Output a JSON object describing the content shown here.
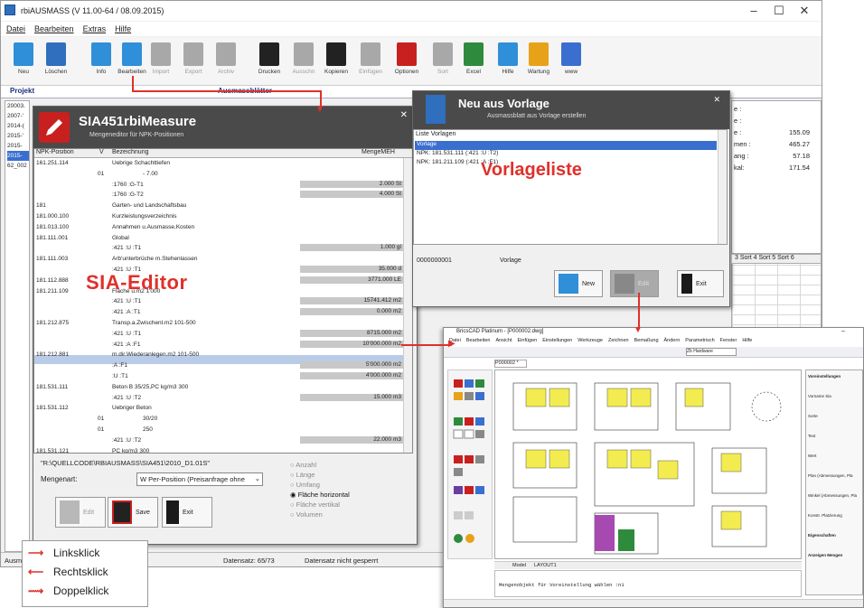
{
  "main": {
    "title": "rbiAUSMASS (V 11.00-64 / 08.09.2015)",
    "menu": [
      "Datei",
      "Bearbeiten",
      "Extras",
      "Hilfe"
    ],
    "toolbar": [
      {
        "label": "Neu",
        "color": "#2f8fd8",
        "enabled": true
      },
      {
        "label": "Löschen",
        "color": "#2f6fbd",
        "enabled": true
      },
      {
        "label": "Info",
        "color": "#2f8fd8",
        "enabled": true
      },
      {
        "label": "Bearbeiten",
        "color": "#2f8fd8",
        "enabled": true
      },
      {
        "label": "Import",
        "color": "#a8a8a8",
        "enabled": false
      },
      {
        "label": "Export",
        "color": "#a8a8a8",
        "enabled": false
      },
      {
        "label": "Archiv",
        "color": "#a8a8a8",
        "enabled": false
      },
      {
        "label": "Drucken",
        "color": "#222222",
        "enabled": true
      },
      {
        "label": "Ausschn",
        "color": "#a8a8a8",
        "enabled": false
      },
      {
        "label": "Kopieren",
        "color": "#222222",
        "enabled": true
      },
      {
        "label": "Einfügen",
        "color": "#a8a8a8",
        "enabled": false
      },
      {
        "label": "Optionen",
        "color": "#c8201f",
        "enabled": true
      },
      {
        "label": "Sort",
        "color": "#a8a8a8",
        "enabled": false
      },
      {
        "label": "Excel",
        "color": "#2e8b3e",
        "enabled": true
      },
      {
        "label": "Hilfe",
        "color": "#2f8fd8",
        "enabled": true
      },
      {
        "label": "Wartung",
        "color": "#e8a21a",
        "enabled": true
      },
      {
        "label": "www",
        "color": "#3a6fd0",
        "enabled": true
      }
    ],
    "panel_left": "Projekt",
    "panel_right": "Ausmassblätter",
    "left_items": [
      "20003.",
      "2007-'",
      "2014-(",
      "2015-'",
      "2015-",
      "2015-",
      "62_002"
    ],
    "right_labels": [
      "e :",
      "e :",
      "e :",
      "men :",
      "ang :",
      "kal:"
    ],
    "right_values": [
      "",
      "",
      "155.09",
      "465.27",
      "57.18",
      "171.54"
    ],
    "sort_header": "3  Sort 4  Sort 5  Sort 6",
    "status": {
      "left": "Ausm",
      "datensatz": "Datensatz: 65/73",
      "gesperrt": "Datensatz nicht gesperrt"
    }
  },
  "sia": {
    "title": "SIA451rbiMeasure",
    "subtitle": "Mengeneditor für NPK-Positionen",
    "cols": {
      "npk": "NPK-Position",
      "v": "V",
      "bez": "Bezeichnung",
      "menge": "MengeMEH"
    },
    "rows": [
      {
        "npk": "161.251.114",
        "v": "",
        "bez": "Uebrige Schachttiefen",
        "menge": ""
      },
      {
        "npk": "",
        "v": "01",
        "bez": "- 7.00",
        "menge": ""
      },
      {
        "npk": "",
        "v": "",
        "bez": ":1760  :G-T1",
        "menge": "2.000 St"
      },
      {
        "npk": "",
        "v": "",
        "bez": ":1760  :G-T2",
        "menge": "4.000 St"
      },
      {
        "npk": "181",
        "v": "",
        "bez": "Garten- und Landschaftsbau",
        "menge": ""
      },
      {
        "npk": "181.000.100",
        "v": "",
        "bez": "Kurzleistungsverzeichnis",
        "menge": ""
      },
      {
        "npk": "181.013.100",
        "v": "",
        "bez": "Annahmen u.Ausmasse,Kosten",
        "menge": ""
      },
      {
        "npk": "181.111.001",
        "v": "",
        "bez": "Global",
        "menge": ""
      },
      {
        "npk": "",
        "v": "",
        "bez": ":421  :U                    :T1",
        "menge": "1.000 gl"
      },
      {
        "npk": "181.111.003",
        "v": "",
        "bez": "Arb'unterbrüche m.Stehenlassen",
        "menge": ""
      },
      {
        "npk": "",
        "v": "",
        "bez": ":421  :U                    :T1",
        "menge": "35.000 d"
      },
      {
        "npk": "181.112.888",
        "v": "",
        "bez": "",
        "menge": "3771.000 LE"
      },
      {
        "npk": "181.211.109",
        "v": "",
        "bez": "Fläche u.m2 1'000",
        "menge": ""
      },
      {
        "npk": "",
        "v": "",
        "bez": ":421  :U                    :T1",
        "menge": "15741.412 m2"
      },
      {
        "npk": "",
        "v": "",
        "bez": ":421  :A                    :T1",
        "menge": "0.000 m2"
      },
      {
        "npk": "181.212.875",
        "v": "",
        "bez": "Transp.a.Zwischenl.m2 101-500",
        "menge": ""
      },
      {
        "npk": "",
        "v": "",
        "bez": ":421  :U                    :T1",
        "menge": "8715.000 m2"
      },
      {
        "npk": "",
        "v": "",
        "bez": ":421  :A                    :F1",
        "menge": "10'000.000 m2"
      },
      {
        "npk": "181.212.881",
        "v": "",
        "bez": "m.dir.Wiederanlegen.m2 101-500",
        "menge": ""
      },
      {
        "npk": "",
        "v": "",
        "bez": ":A                     :F1",
        "menge": "5'000.000 m2"
      },
      {
        "npk": "",
        "v": "",
        "bez": ":U                     :T1",
        "menge": "4'000.000 m2"
      },
      {
        "npk": "181.531.111",
        "v": "",
        "bez": "Beton B 35/25,PC kg/m3 300",
        "menge": ""
      },
      {
        "npk": "",
        "v": "",
        "bez": ":421  :U                    :T2",
        "menge": "15.000 m3"
      },
      {
        "npk": "181.531.112",
        "v": "",
        "bez": "Uebriger Beton",
        "menge": ""
      },
      {
        "npk": "",
        "v": "01",
        "bez": "30/20",
        "menge": ""
      },
      {
        "npk": "",
        "v": "01",
        "bez": "250",
        "menge": ""
      },
      {
        "npk": "",
        "v": "",
        "bez": ":421  :U                    :T2",
        "menge": "22.000 m3"
      },
      {
        "npk": "181.531.121",
        "v": "",
        "bez": "PC kg/m3 300",
        "menge": ""
      }
    ],
    "path": "\"R:\\QUELLCODE\\RBIAUSMASS\\SIA451\\2010_D1.01S\"",
    "mengenart_label": "Mengenart:",
    "mengenart_value": "W Per-Position (Preisanfrage ohne",
    "radios": [
      "Anzahl",
      "Länge",
      "Umfang",
      "Fläche horizontal",
      "Fläche vertikal",
      "Volumen"
    ],
    "radio_selected": 3,
    "buttons": {
      "edit": "Edit",
      "save": "Save",
      "exit": "Exit"
    },
    "tag": "SIA-Editor"
  },
  "vorlage": {
    "title": "Neu aus Vorlage",
    "subtitle": "Ausmassblatt aus Vorlage erstellen",
    "list_header": "Liste Vorlagen",
    "items": [
      "Vorlage",
      "NPK: 181.531.111 (:421   :U                        :T2)",
      "NPK: 181.211.109 (:421   :A                        :F1)"
    ],
    "tag": "Vorlageliste",
    "footer_id": "0000000001",
    "footer_name": "Vorlage",
    "buttons": {
      "new": "New",
      "edit": "Edit",
      "exit": "Exit"
    }
  },
  "cad": {
    "title": "BricsCAD Platinum - [P000002.dwg]",
    "menu": [
      "Datei",
      "Bearbeiten",
      "Ansicht",
      "Einfügen",
      "Einstellungen",
      "Werkzeuge",
      "Zeichnen",
      "Bemaßung",
      "Ändern",
      "Parametrisch",
      "Fenster",
      "Hilfe"
    ],
    "tab": "P000002 *",
    "layer": "Zb Hardware",
    "prompt": "Mengenobjekt für Voreinstellung wählen :n1",
    "model_tab": "Model",
    "layout_tab": "LAYOUT1",
    "props": [
      "Voreinstellungen",
      "Vorname Sia",
      "Sorte",
      "Text",
      "Wert",
      "Plan (Abmessungen, Pla",
      "Winkel (Abmessungen, Pla",
      "Konstr. Platzierung",
      "Eigenschaften",
      "Anzeigen Mengen"
    ]
  },
  "legend": [
    {
      "arrow": "⟶",
      "label": "Linksklick"
    },
    {
      "arrow": "⟵",
      "label": "Rechtsklick"
    },
    {
      "arrow": "⟿",
      "label": "Doppelklick"
    }
  ]
}
